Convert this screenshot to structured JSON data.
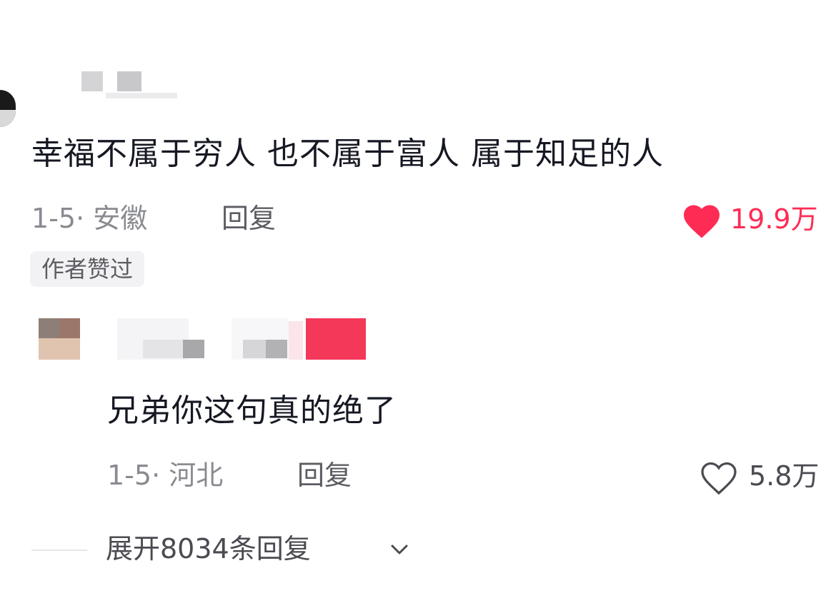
{
  "comments": [
    {
      "text": "幸福不属于穷人 也不属于富人 属于知足的人",
      "date_location": "1-5· 安徽",
      "reply_label": "回复",
      "like_count": "19.9万",
      "liked": true,
      "badge": "作者赞过"
    },
    {
      "text": "兄弟你这句真的绝了",
      "date_location": "1-5· 河北",
      "reply_label": "回复",
      "like_count": "5.8万",
      "liked": false
    }
  ],
  "expand_replies_label": "展开8034条回复",
  "icons": {
    "like_filled": "heart-filled-icon",
    "like_outline": "heart-outline-icon",
    "expand": "chevron-down-icon"
  },
  "colors": {
    "liked": "#fe2c55",
    "text": "#161823",
    "meta": "#8a8b91"
  }
}
